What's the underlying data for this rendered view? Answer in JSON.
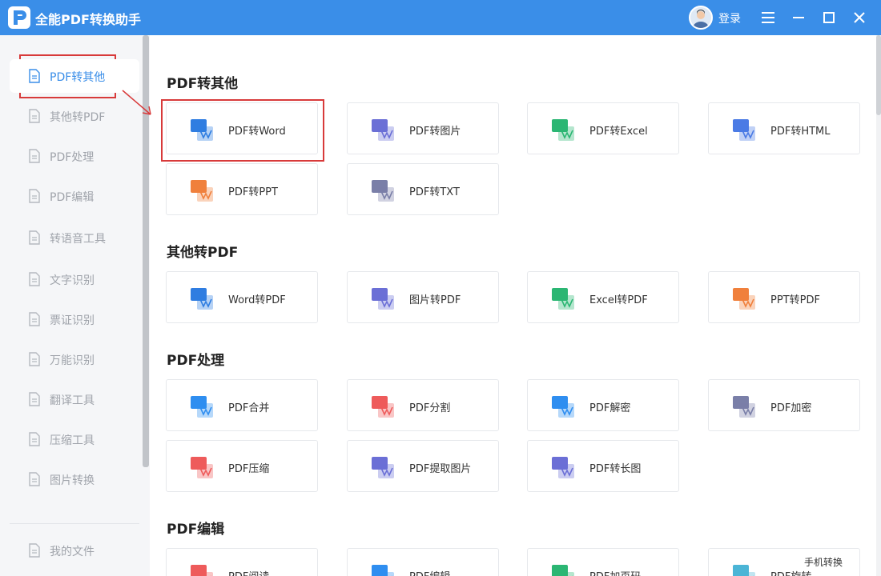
{
  "app": {
    "title": "全能PDF转换助手",
    "login_label": "登录"
  },
  "colors": {
    "primary": "#3a8ee8",
    "highlight": "#d83a3a"
  },
  "sidebar": {
    "items": [
      {
        "label": "PDF转其他",
        "icon": "pdf-icon",
        "active": true
      },
      {
        "label": "其他转PDF",
        "icon": "pdf-icon"
      },
      {
        "label": "PDF处理",
        "icon": "pdf-process-icon"
      },
      {
        "label": "PDF编辑",
        "icon": "pdf-edit-icon"
      },
      {
        "label": "转语音工具",
        "icon": "speech-icon"
      },
      {
        "label": "文字识别",
        "icon": "ocr-icon"
      },
      {
        "label": "票证识别",
        "icon": "ticket-icon"
      },
      {
        "label": "万能识别",
        "icon": "recognize-icon"
      },
      {
        "label": "翻译工具",
        "icon": "translate-icon"
      },
      {
        "label": "压缩工具",
        "icon": "compress-icon"
      },
      {
        "label": "图片转换",
        "icon": "image-icon"
      },
      {
        "label": "我的文件",
        "icon": "file-icon"
      }
    ]
  },
  "sections": [
    {
      "title": "PDF转其他",
      "cards": [
        {
          "label": "PDF转Word",
          "icon": "pdf-to-word-icon",
          "color": "#2f7de1"
        },
        {
          "label": "PDF转图片",
          "icon": "pdf-to-image-icon",
          "color": "#6b6fd6"
        },
        {
          "label": "PDF转Excel",
          "icon": "pdf-to-excel-icon",
          "color": "#2bb673"
        },
        {
          "label": "PDF转HTML",
          "icon": "pdf-to-html-icon",
          "color": "#4b7be5"
        },
        {
          "label": "PDF转PPT",
          "icon": "pdf-to-ppt-icon",
          "color": "#f0803c"
        },
        {
          "label": "PDF转TXT",
          "icon": "pdf-to-txt-icon",
          "color": "#7a7fa8"
        }
      ]
    },
    {
      "title": "其他转PDF",
      "cards": [
        {
          "label": "Word转PDF",
          "icon": "word-to-pdf-icon",
          "color": "#2f7de1"
        },
        {
          "label": "图片转PDF",
          "icon": "image-to-pdf-icon",
          "color": "#6b6fd6"
        },
        {
          "label": "Excel转PDF",
          "icon": "excel-to-pdf-icon",
          "color": "#2bb673"
        },
        {
          "label": "PPT转PDF",
          "icon": "ppt-to-pdf-icon",
          "color": "#f0803c"
        }
      ]
    },
    {
      "title": "PDF处理",
      "cards": [
        {
          "label": "PDF合并",
          "icon": "merge-icon",
          "color": "#2f8ef0"
        },
        {
          "label": "PDF分割",
          "icon": "split-icon",
          "color": "#ee5b5b"
        },
        {
          "label": "PDF解密",
          "icon": "decrypt-icon",
          "color": "#2f8ef0"
        },
        {
          "label": "PDF加密",
          "icon": "encrypt-icon",
          "color": "#7a7fa8"
        },
        {
          "label": "PDF压缩",
          "icon": "compress-doc-icon",
          "color": "#ee5b5b"
        },
        {
          "label": "PDF提取图片",
          "icon": "extract-image-icon",
          "color": "#6b6fd6"
        },
        {
          "label": "PDF转长图",
          "icon": "long-image-icon",
          "color": "#6b6fd6"
        }
      ]
    },
    {
      "title": "PDF编辑",
      "cards": [
        {
          "label": "PDF阅读",
          "icon": "read-icon",
          "color": "#ee5b5b"
        },
        {
          "label": "PDF编辑",
          "icon": "edit-icon",
          "color": "#2f8ef0"
        },
        {
          "label": "PDF加页码",
          "icon": "page-number-icon",
          "color": "#2bb673"
        },
        {
          "label": "PDF旋转",
          "icon": "rotate-icon",
          "color": "#4bb5d6"
        }
      ]
    }
  ],
  "footer": {
    "phone_convert_label": "手机转换"
  }
}
